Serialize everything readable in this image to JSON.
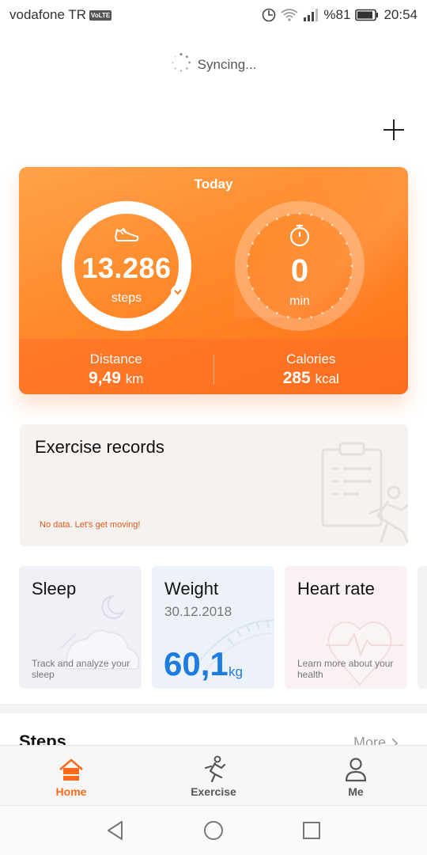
{
  "status_bar": {
    "carrier": "vodafone TR",
    "volte": "VoLTE",
    "battery": "%81",
    "time": "20:54"
  },
  "sync": {
    "text": "Syncing..."
  },
  "today": {
    "title": "Today",
    "steps_value": "13.286",
    "steps_unit": "steps",
    "exercise_minutes": "0",
    "minutes_unit": "min",
    "steps_progress": 1.0,
    "distance_label": "Distance",
    "distance_value": "9,49",
    "distance_unit": "km",
    "calories_label": "Calories",
    "calories_value": "285",
    "calories_unit": "kcal"
  },
  "exercise_records": {
    "title": "Exercise records",
    "empty_text": "No data. Let's get moving!"
  },
  "cards": {
    "sleep": {
      "title": "Sleep",
      "desc": "Track and analyze your sleep"
    },
    "weight": {
      "title": "Weight",
      "date": "30.12.2018",
      "value": "60,1",
      "unit": "kg"
    },
    "heart": {
      "title": "Heart rate",
      "desc": "Learn more about your health"
    }
  },
  "steps_section": {
    "title": "Steps",
    "more": "More"
  },
  "bottom_nav": {
    "home": "Home",
    "exercise": "Exercise",
    "me": "Me"
  },
  "colors": {
    "accent": "#ff6a1a",
    "weight_blue": "#1e7ce0",
    "nodata_orange": "#e0591b"
  }
}
